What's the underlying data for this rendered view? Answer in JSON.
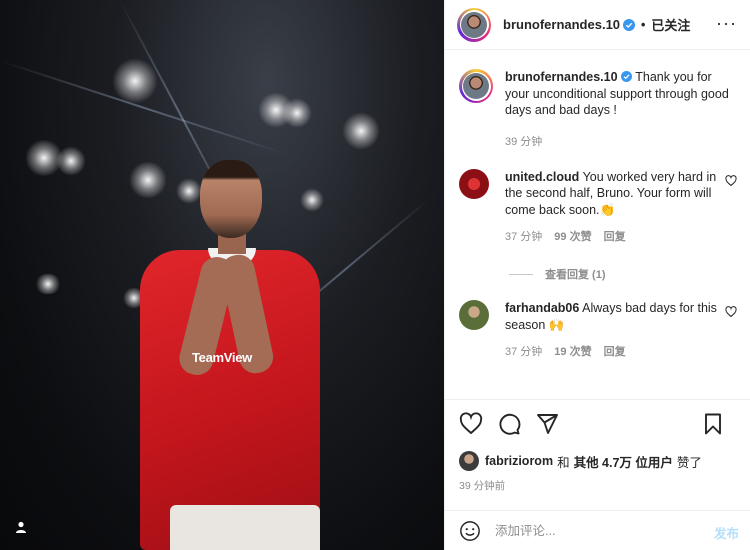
{
  "post": {
    "author": "brunofernandes.10",
    "follow_status": "已关注",
    "caption": "Thank you for your unconditional support through good days and bad days !",
    "caption_time": "39 分钟"
  },
  "comments": [
    {
      "user": "united.cloud",
      "text": "You worked very hard in the second half, Bruno. Your form will come back soon.👏",
      "time": "37 分钟",
      "likes": "99 次赞",
      "reply": "回复",
      "view_replies": "查看回复 (1)"
    },
    {
      "user": "farhandab06",
      "text": "Always bad days for this season 🙌",
      "time": "37 分钟",
      "likes": "19 次赞",
      "reply": "回复"
    }
  ],
  "likes_line": {
    "user": "fabriziorom",
    "and": "和",
    "others": "其他 4.7万 位用户",
    "liked": "赞了"
  },
  "post_time": "39 分钟前",
  "comment_box": {
    "placeholder": "添加评论...",
    "post_label": "发布"
  },
  "icons": {
    "verified_color": "#3897f0",
    "accent_post": "#b2dffc"
  },
  "photo": {
    "sponsor_text": "TeamView"
  }
}
